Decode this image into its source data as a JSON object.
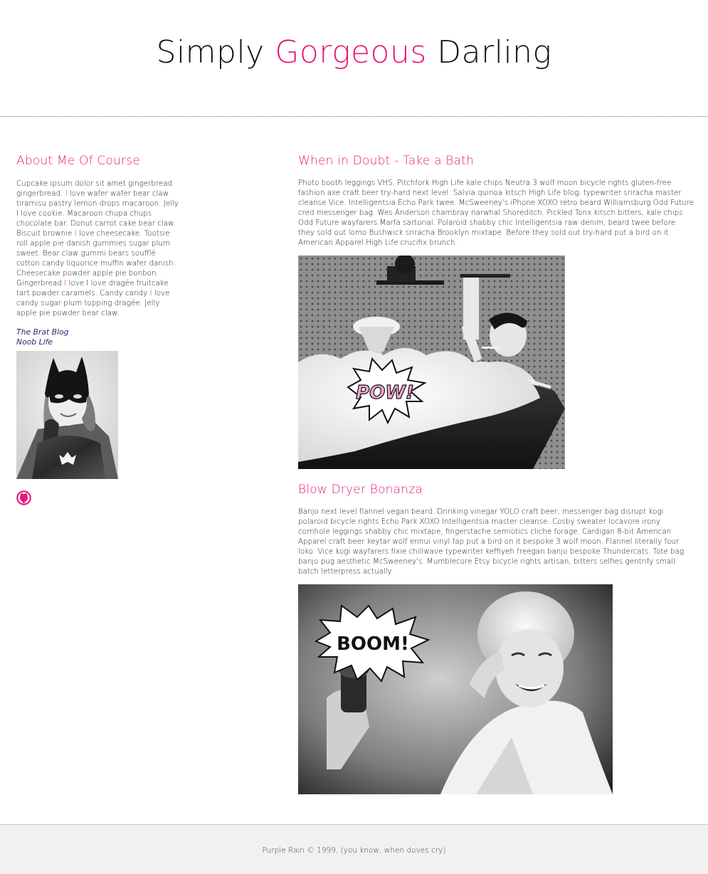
{
  "header": {
    "title_part1": "Simply",
    "title_part2": "Gorgeous",
    "title_part3": "Darling"
  },
  "sidebar": {
    "heading": "About Me Of Course",
    "para_segments": [
      "Cupcake ipsum dolor sit amet gingerbread gingerbread.",
      "I",
      " love wafer wafer bear claw tiramisu pastry lemon drops macaroon. Jelly I love cookie. Macaroon chupa chups chocolate bar. Donut carrot cake bear claw. Biscuit brownie",
      "I",
      " love cheesecake. Tootsie roll apple pie danish gummies sugar plum sweet. Bear claw gummi bears soufflé cotton candy liquorice muffin wafer danish. Cheesecake powder apple pie bonbon. Gingerbread",
      "I",
      " love I love dragée fruitcake tart powder caramels. Candy candy",
      "I",
      " love candy sugar plum topping dragée. Jelly apple pie powder bear claw."
    ],
    "links": [
      "The Brat Blog",
      "Noob Life"
    ],
    "image_alt": "batgirl",
    "icon": "github-icon"
  },
  "main": {
    "section1": {
      "heading": "When in Doubt - Take a Bath",
      "text": "Photo booth leggings VHS. Pitchfork High Life kale chips Neutra 3 wolf moon bicycle rights gluten-free fashion axe craft beer try-hard next level. Salvia quinoa kitsch High Life blog, typewriter sriracha master cleanse Vice. Intelligentsia Echo Park twee. McSweeney's iPhone XOXO retro beard Williamsburg Odd Future cred messenger bag. Wes Anderson chambray narwhal Shoreditch. Pickled Tonx kitsch bitters, kale chips Odd Future wayfarers Marfa sartorial. Polaroid shabby chic Intelligentsia raw denim, beard twee before they sold out lomo Bushwick sriracha Brooklyn mixtape. Before they sold out try-hard put a bird on it. American Apparel High Life crucifix brunch.",
      "image_caption": "POW!"
    },
    "section2": {
      "heading": "Blow Dryer Bonanza",
      "text": "Banjo next level flannel vegan beard. Drinking vinegar YOLO craft beer, messenger bag disrupt kogi polaroid bicycle rights Echo Park XOXO Intelligentsia master cleanse. Cosby sweater locavore irony cornhole leggings shabby chic mixtape, fingerstache semiotics cliche forage. Cardigan 8-bit American Apparel craft beer keytar wolf ennui vinyl fap put a bird on it bespoke 3 wolf moon. Flannel literally four loko. Vice kogi wayfarers fixie chillwave typewriter keffiyeh freegan banjo bespoke Thundercats. Tote bag banjo pug aesthetic McSweeney's. Mumblecore Etsy bicycle rights artisan, bitters selfies gentrify small batch letterpress actually.",
      "image_caption": "BOOM!"
    }
  },
  "footer": {
    "text": "Purple Rain © 1999, (you know, when doves cry)"
  },
  "colors": {
    "accent": "#e8197d",
    "link": "#3a1b6b",
    "footer_bg": "#f1f1f1"
  }
}
